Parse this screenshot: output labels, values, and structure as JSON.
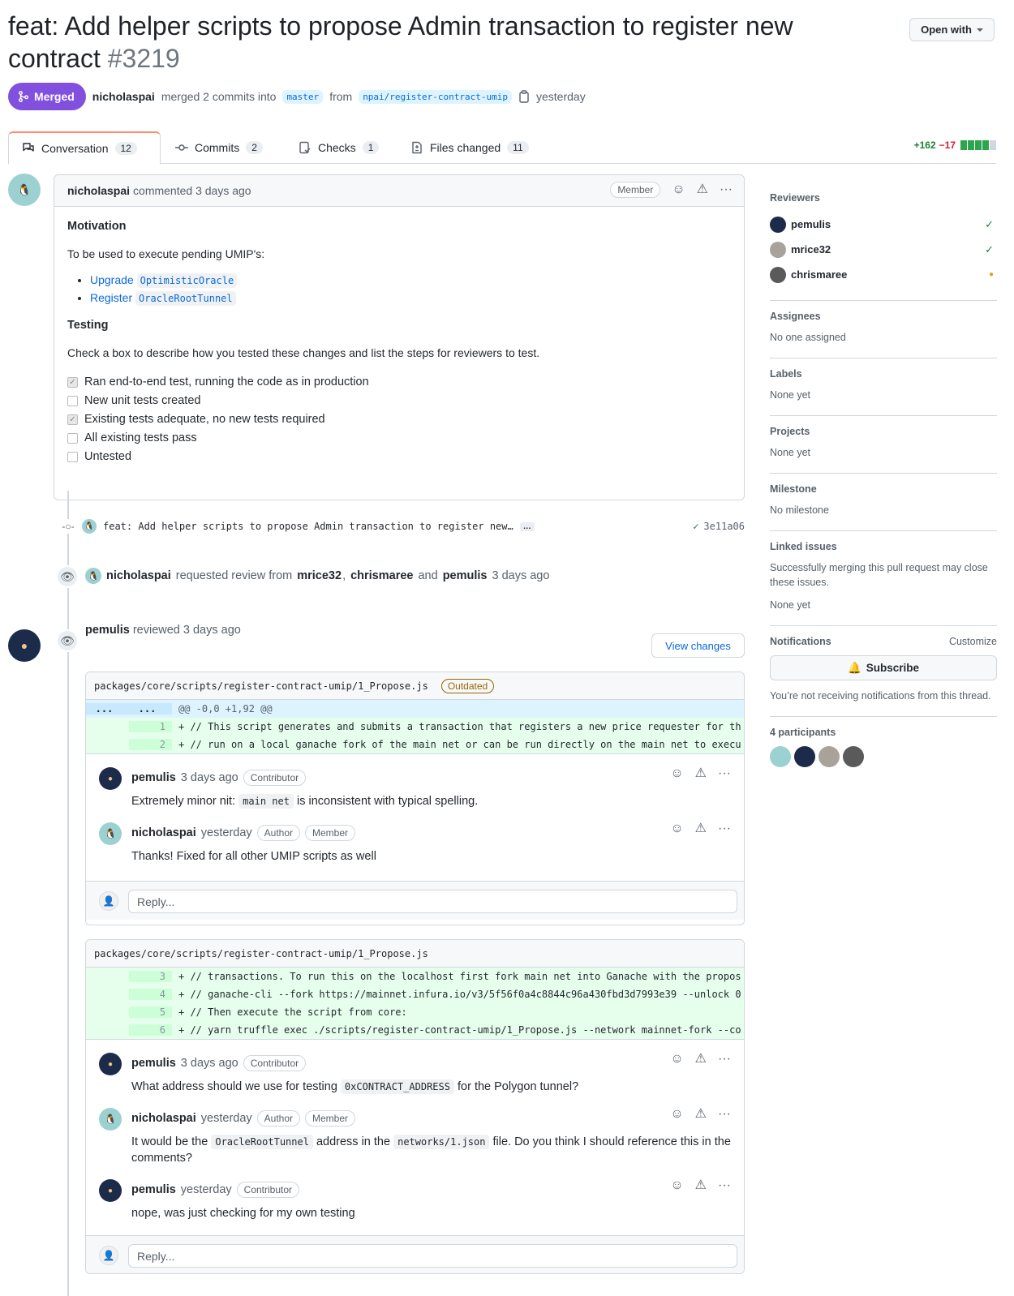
{
  "pr": {
    "title": "feat: Add helper scripts to propose Admin transaction to register new contract",
    "number": "#3219",
    "status": "Merged",
    "author": "nicholaspai",
    "merge_text": "merged 2 commits into",
    "base_branch": "master",
    "from_text": "from",
    "head_branch": "npai/register-contract-umip",
    "time": "yesterday",
    "open_with": "Open with"
  },
  "tabs": [
    {
      "label": "Conversation",
      "count": "12"
    },
    {
      "label": "Commits",
      "count": "2"
    },
    {
      "label": "Checks",
      "count": "1"
    },
    {
      "label": "Files changed",
      "count": "11"
    }
  ],
  "diffstat": {
    "additions": "+162",
    "deletions": "−17"
  },
  "main_comment": {
    "author": "nicholaspai",
    "action": "commented 3 days ago",
    "badge": "Member",
    "heading1": "Motivation",
    "intro": "To be used to execute pending UMIP's:",
    "links": [
      {
        "text": "Upgrade",
        "code": "OptimisticOracle"
      },
      {
        "text": "Register",
        "code": "OracleRootTunnel"
      }
    ],
    "heading2": "Testing",
    "testing_intro": "Check a box to describe how you tested these changes and list the steps for reviewers to test.",
    "tasks": [
      {
        "label": "Ran end-to-end test, running the code as in production",
        "checked": true
      },
      {
        "label": "New unit tests created",
        "checked": false
      },
      {
        "label": "Existing tests adequate, no new tests required",
        "checked": true
      },
      {
        "label": "All existing tests pass",
        "checked": false
      },
      {
        "label": "Untested",
        "checked": false
      }
    ]
  },
  "commit": {
    "message": "feat: Add helper scripts to propose Admin transaction to register new…",
    "ellipsis": "…",
    "sha": "3e11a06"
  },
  "review_request": {
    "author": "nicholaspai",
    "text": "requested review from",
    "reviewer1": "mrice32",
    "sep": ",",
    "reviewer2": "chrismaree",
    "and": "and",
    "reviewer3": "pemulis",
    "time": "3 days ago"
  },
  "review": {
    "author": "pemulis",
    "text": "reviewed 3 days ago",
    "view_changes": "View changes"
  },
  "thread1": {
    "file": "packages/core/scripts/register-contract-umip/1_Propose.js",
    "outdated": "Outdated",
    "hunk_left": "...",
    "hunk_right": "...",
    "hunk": "@@ -0,0 +1,92 @@",
    "lines": [
      {
        "n": "1",
        "code": "+ // This script generates and submits a transaction that registers a new price requester for th"
      },
      {
        "n": "2",
        "code": "+ // run on a local ganache fork of the main net or can be run directly on the main net to execu"
      }
    ],
    "comments": [
      {
        "author": "pemulis",
        "time": "3 days ago",
        "badges": [
          "Contributor"
        ],
        "pre": "Extremely minor nit: ",
        "code": "main net",
        "post": " is inconsistent with typical spelling."
      },
      {
        "author": "nicholaspai",
        "time": "yesterday",
        "badges": [
          "Author",
          "Member"
        ],
        "text": "Thanks! Fixed for all other UMIP scripts as well"
      }
    ],
    "reply": "Reply..."
  },
  "thread2": {
    "file": "packages/core/scripts/register-contract-umip/1_Propose.js",
    "lines": [
      {
        "n": "3",
        "code": "+ // transactions. To run this on the localhost first fork main net into Ganache with the propos"
      },
      {
        "n": "4",
        "code": "+ // ganache-cli --fork https://mainnet.infura.io/v3/5f56f0a4c8844c96a430fbd3d7993e39 --unlock 0"
      },
      {
        "n": "5",
        "code": "+ // Then execute the script from core:"
      },
      {
        "n": "6",
        "code": "+ // yarn truffle exec ./scripts/register-contract-umip/1_Propose.js --network mainnet-fork --co"
      }
    ],
    "comments": [
      {
        "author": "pemulis",
        "time": "3 days ago",
        "badges": [
          "Contributor"
        ],
        "pre": "What address should we use for testing ",
        "code": "0xCONTRACT_ADDRESS",
        "post": " for the Polygon tunnel?"
      },
      {
        "author": "nicholaspai",
        "time": "yesterday",
        "badges": [
          "Author",
          "Member"
        ],
        "pre": "It would be the ",
        "code": "OracleRootTunnel",
        "mid": " address in the ",
        "code2": "networks/1.json",
        "post": " file. Do you think I should reference this in the comments?"
      },
      {
        "author": "pemulis",
        "time": "yesterday",
        "badges": [
          "Contributor"
        ],
        "text": "nope, was just checking for my own testing"
      }
    ],
    "reply": "Reply..."
  },
  "sidebar": {
    "reviewers_title": "Reviewers",
    "reviewers": [
      {
        "name": "pemulis",
        "status": "approved"
      },
      {
        "name": "mrice32",
        "status": "approved"
      },
      {
        "name": "chrismaree",
        "status": "pending"
      }
    ],
    "assignees_title": "Assignees",
    "assignees": "No one assigned",
    "labels_title": "Labels",
    "labels": "None yet",
    "projects_title": "Projects",
    "projects": "None yet",
    "milestone_title": "Milestone",
    "milestone": "No milestone",
    "linked_title": "Linked issues",
    "linked_desc": "Successfully merging this pull request may close these issues.",
    "linked": "None yet",
    "notifications_title": "Notifications",
    "customize": "Customize",
    "subscribe": "Subscribe",
    "notif_desc": "You’re not receiving notifications from this thread.",
    "participants": "4 participants"
  },
  "colors": {
    "merged": "#8250df",
    "link": "#0969da",
    "added": "#1a7f37",
    "removed": "#cf222e",
    "pending": "#d4a72c"
  }
}
